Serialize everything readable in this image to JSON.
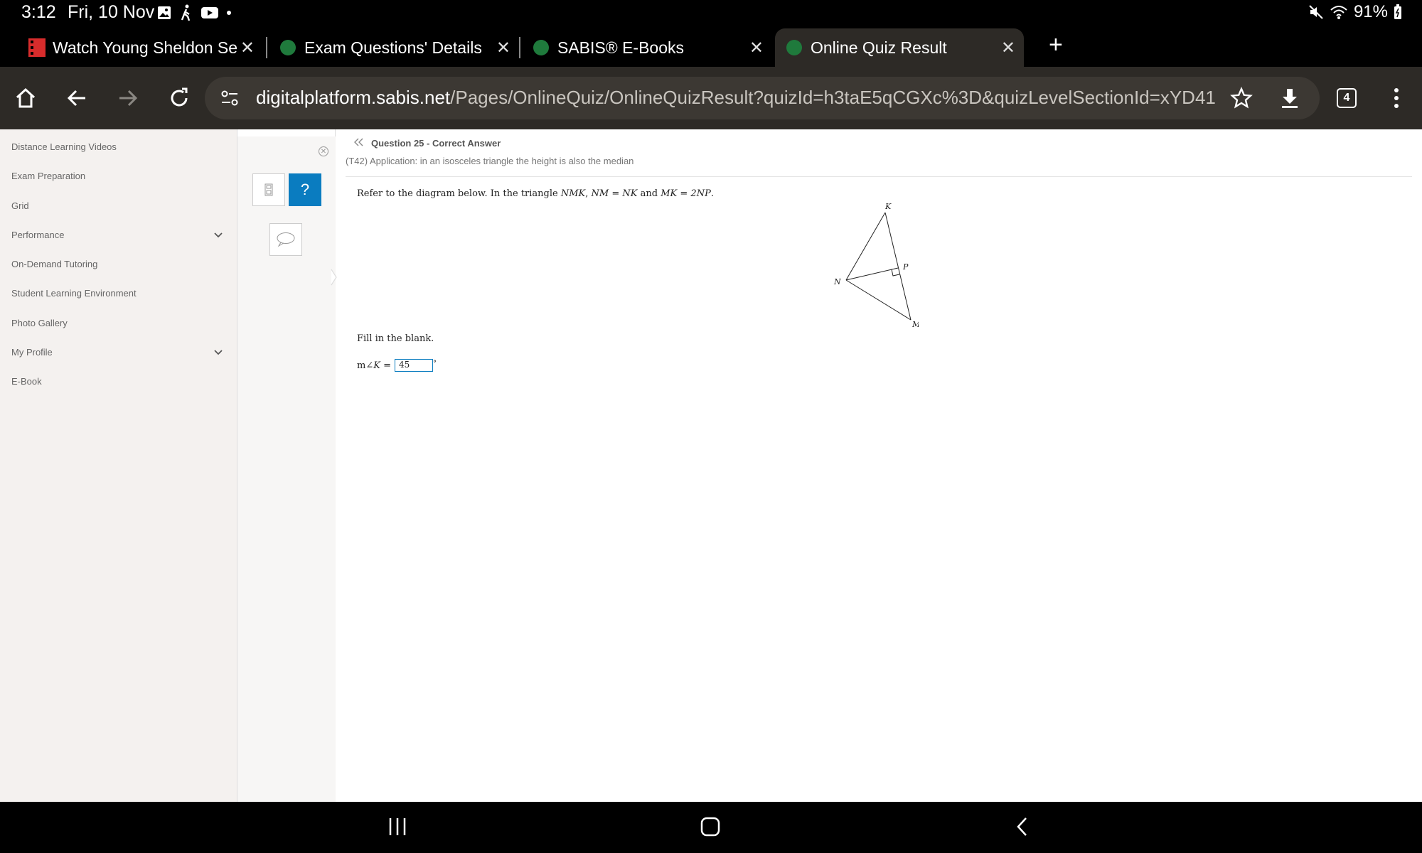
{
  "status": {
    "time": "3:12",
    "date": "Fri, 10 Nov",
    "battery": "91%",
    "left_icons": [
      "gallery-icon",
      "walking-icon",
      "youtube-icon",
      "dot-icon"
    ],
    "right_icons": [
      "mute-icon",
      "wifi-icon",
      "battery-icon"
    ]
  },
  "tabs": [
    {
      "title": "Watch Young Sheldon Se",
      "favicon": "red-film-icon"
    },
    {
      "title": "Exam Questions' Details",
      "favicon": "sabis-tree-icon"
    },
    {
      "title": "SABIS® E-Books",
      "favicon": "sabis-tree-icon"
    },
    {
      "title": "Online Quiz Result",
      "favicon": "sabis-tree-icon",
      "active": true
    }
  ],
  "toolbar": {
    "url_domain": "digitalplatform.sabis.net",
    "url_path": "/Pages/OnlineQuiz/OnlineQuizResult?quizId=h3taE5qCGXc%3D&quizLevelSectionId=xYD41",
    "tab_count": "4"
  },
  "sidebar": {
    "items": [
      {
        "label": "Distance Learning Videos"
      },
      {
        "label": "Exam Preparation"
      },
      {
        "label": "Grid"
      },
      {
        "label": "Performance",
        "expandable": true
      },
      {
        "label": "On-Demand Tutoring"
      },
      {
        "label": "Student Learning Environment"
      },
      {
        "label": "Photo Gallery"
      },
      {
        "label": "My Profile",
        "expandable": true
      },
      {
        "label": "E-Book"
      }
    ]
  },
  "tools": {
    "help_label": "?"
  },
  "question": {
    "header": "Question 25 - Correct Answer",
    "subtitle": "(T42) Application: in an isosceles triangle the height is also the median",
    "prompt_start": "Refer to the diagram below. In the triangle ",
    "prompt_tri": "NMK",
    "prompt_sep": ", ",
    "prompt_eq1": "NM",
    "prompt_eq2": "NK",
    "prompt_and": "and",
    "prompt_mk": "MK",
    "prompt_2np": "2NP",
    "fill_label": "Fill in the blank.",
    "answer_prefix": "m∠",
    "answer_var": "K",
    "answer_eq": "=",
    "answer_value": "45",
    "answer_unit": "°",
    "diagram_labels": {
      "k": "K",
      "p": "P",
      "n": "N",
      "m": "M"
    }
  },
  "navbar": [
    "recents-icon",
    "home-icon",
    "back-icon"
  ]
}
